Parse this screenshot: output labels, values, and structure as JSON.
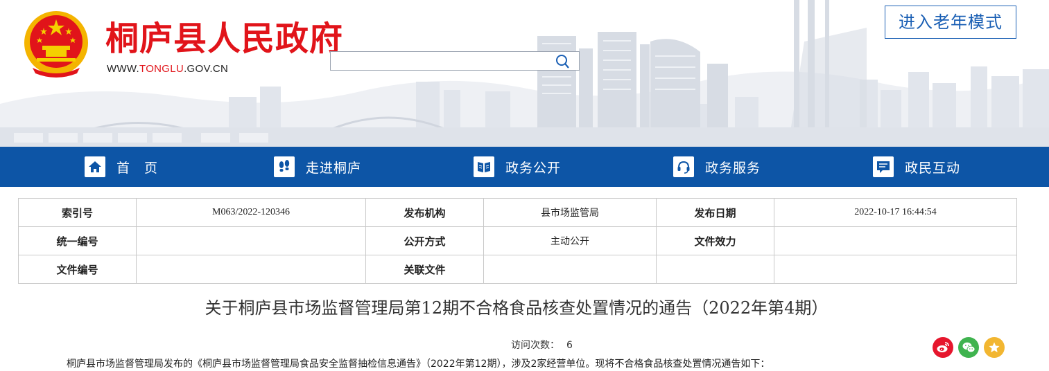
{
  "header": {
    "site_title": "桐庐县人民政府",
    "url_prefix": "WWW.",
    "url_highlight": "TONGLU",
    "url_suffix": ".GOV.CN",
    "search": {
      "value": "",
      "placeholder": ""
    },
    "elder_mode_label": "进入老年模式"
  },
  "nav": {
    "items": [
      {
        "label": "首　页",
        "icon": "home-icon"
      },
      {
        "label": "走进桐庐",
        "icon": "footprints-icon"
      },
      {
        "label": "政务公开",
        "icon": "book-icon"
      },
      {
        "label": "政务服务",
        "icon": "headset-icon"
      },
      {
        "label": "政民互动",
        "icon": "message-icon"
      }
    ]
  },
  "meta": {
    "rows": [
      [
        {
          "key": "索引号",
          "value": "M063/2022-120346"
        },
        {
          "key": "发布机构",
          "value": "县市场监管局"
        },
        {
          "key": "发布日期",
          "value": "2022-10-17 16:44:54"
        }
      ],
      [
        {
          "key": "统一编号",
          "value": ""
        },
        {
          "key": "公开方式",
          "value": "主动公开"
        },
        {
          "key": "文件效力",
          "value": ""
        }
      ],
      [
        {
          "key": "文件编号",
          "value": ""
        },
        {
          "key": "关联文件",
          "value": ""
        },
        {
          "key": "",
          "value": ""
        }
      ]
    ]
  },
  "article": {
    "title": "关于桐庐县市场监督管理局第12期不合格食品核查处置情况的通告（2022年第4期）",
    "visits_label": "访问次数：",
    "visits_count": "6",
    "intro": "桐庐县市场监督管理局发布的《桐庐县市场监督管理局食品安全监督抽检信息通告》（2022年第12期），涉及2家经营单位。现将不合格食品核查处置情况通告如下："
  },
  "share": {
    "items": [
      {
        "icon": "weibo-icon",
        "color": "#e6162d"
      },
      {
        "icon": "wechat-icon",
        "color": "#3fb34f"
      },
      {
        "icon": "star-icon",
        "color": "#f2b631"
      }
    ]
  },
  "colors": {
    "brand_red": "#e1141a",
    "nav_blue": "#0d55a6",
    "accent_blue": "#1a5fb4"
  }
}
